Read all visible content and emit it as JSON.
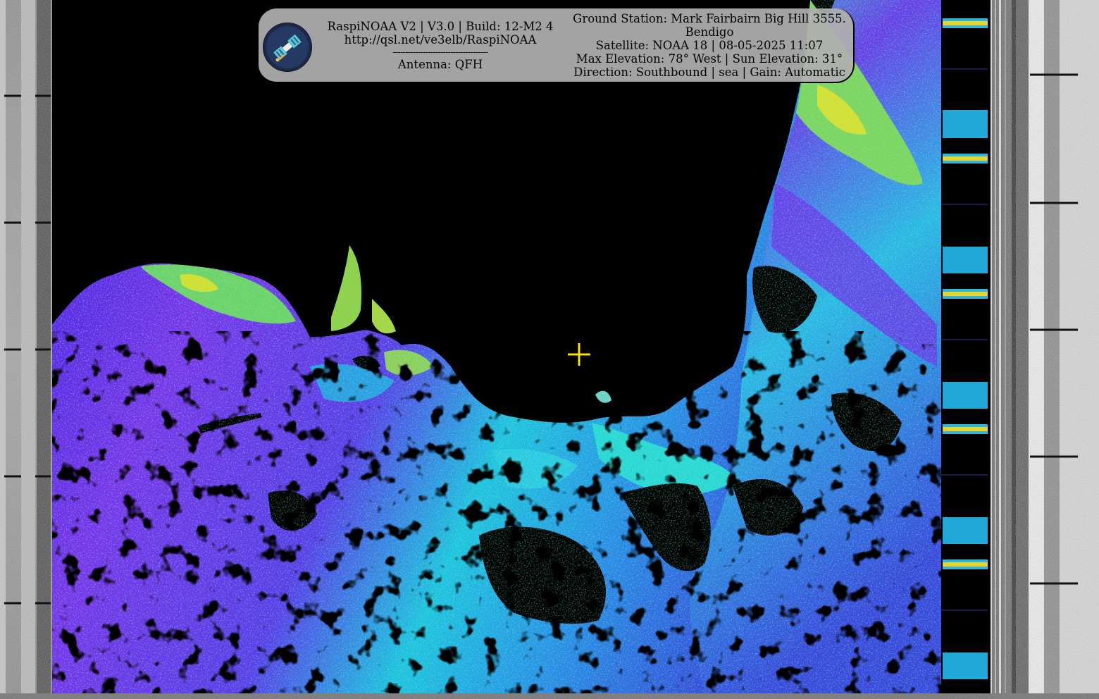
{
  "header": {
    "left": {
      "title": "RaspiNOAA V2 | V3.0 | Build: 12-M2 4",
      "url": "http://qsl.net/ve3elb/RaspiNOAA",
      "divider": "--------------------------------------",
      "antenna": "Antenna: QFH"
    },
    "right": {
      "station_line1": "Ground Station: Mark Fairbairn Big Hill 3555.",
      "station_line2": "Bendigo",
      "satellite": "Satellite: NOAA 18 | 08-05-2025 11:07",
      "elevation": "Max Elevation: 78° West | Sun Elevation: 31°",
      "direction": "Direction: Southbound | sea | Gain: Automatic"
    }
  },
  "logo": {
    "icon": "satellite-logo-icon"
  },
  "marker": {
    "icon": "crosshair-icon",
    "color": "#f4e400"
  },
  "palette": {
    "background": "#000000",
    "deep_blue": "#3a1fd6",
    "violet": "#8a3bf0",
    "cyan": "#28d7e6",
    "green": "#6bd36a",
    "yellow": "#e8e020"
  }
}
